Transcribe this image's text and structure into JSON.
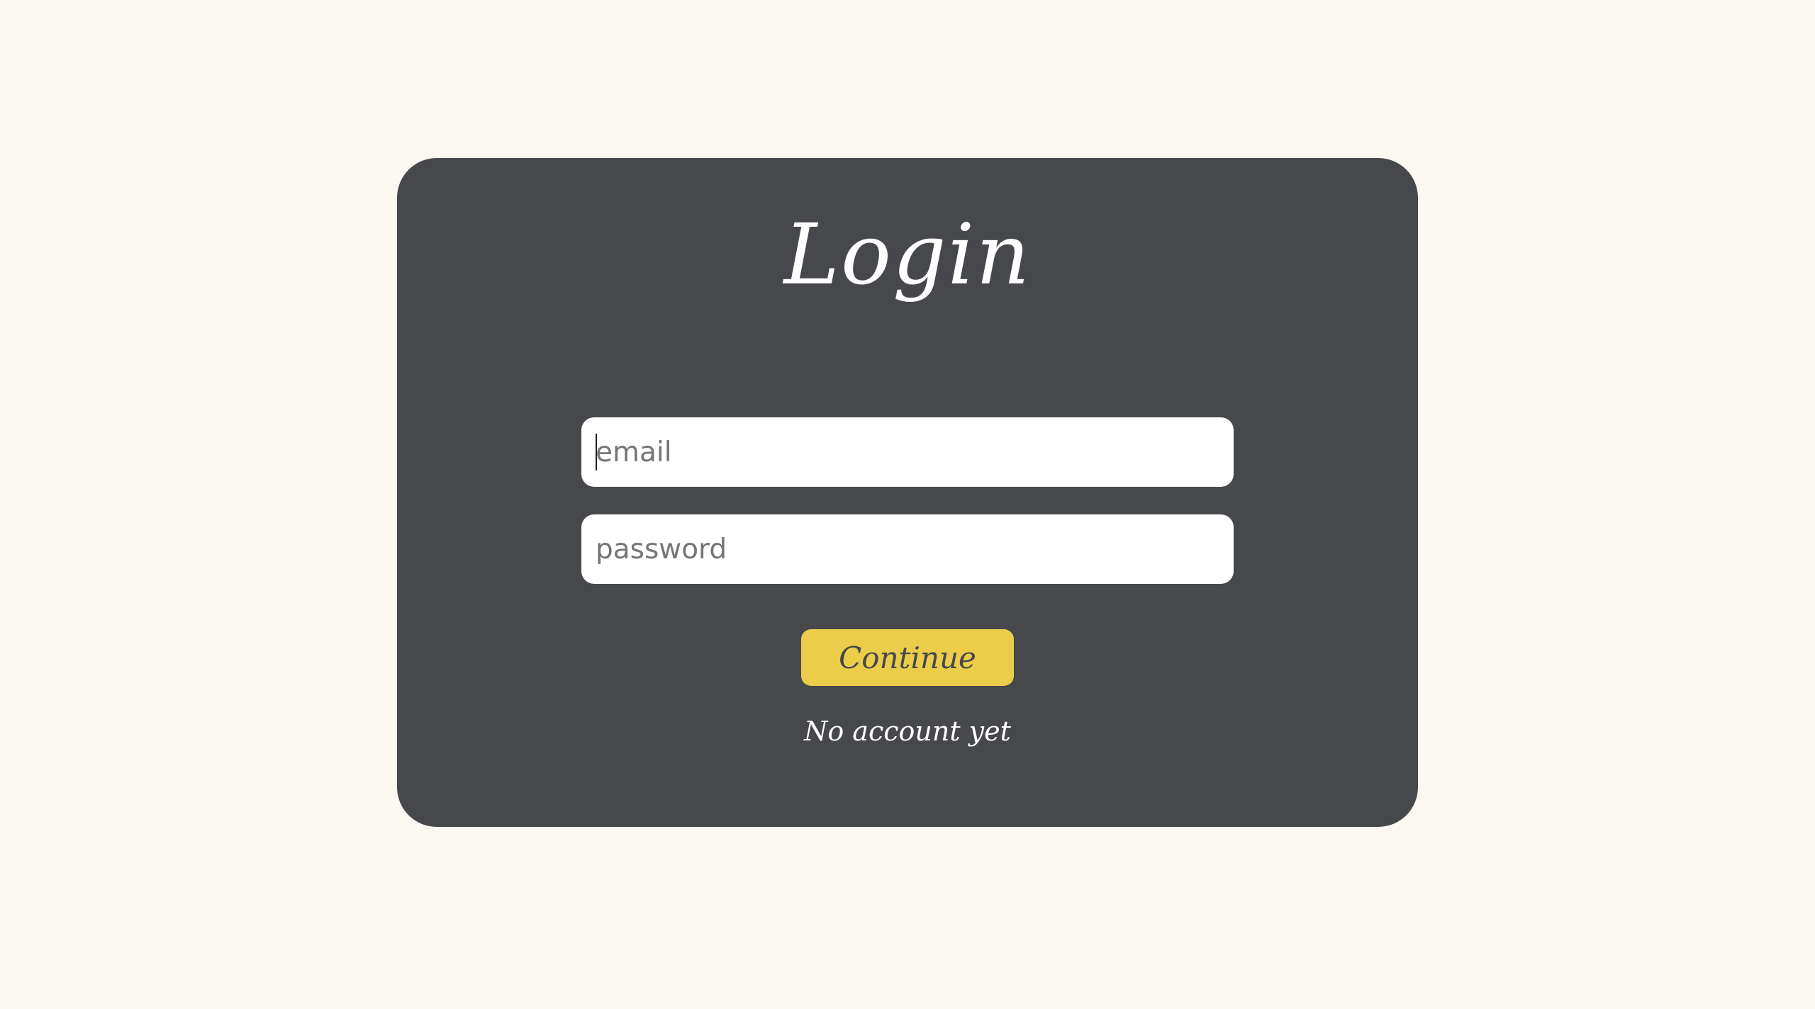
{
  "login": {
    "title": "Login",
    "email_placeholder": "email",
    "password_placeholder": "password",
    "continue_label": "Continue",
    "no_account_link": "No account yet"
  },
  "colors": {
    "background": "#fbf8f1",
    "card": "#47484c",
    "button": "#ebcd4a",
    "text_light": "#ffffff"
  }
}
